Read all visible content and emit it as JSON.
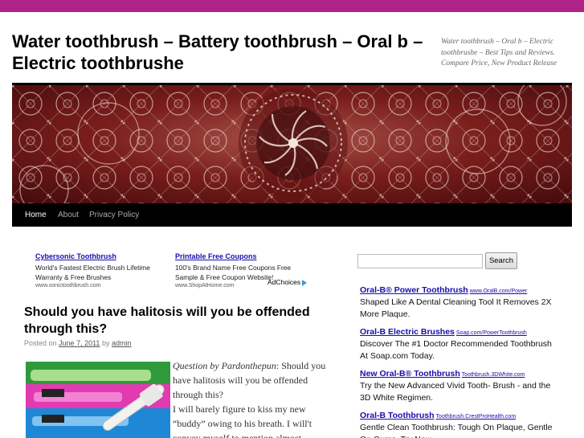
{
  "site": {
    "title": "Water toothbrush – Battery toothbrush – Oral b – Electric toothbrushe",
    "description": "Water toothbrush – Oral b – Electric toothbrushe – Best Tips and Reviews. Compare Price, New Product Release",
    "accent_color": "#b0238a"
  },
  "nav": {
    "items": [
      {
        "label": "Home",
        "active": true
      },
      {
        "label": "About",
        "active": false
      },
      {
        "label": "Privacy Policy",
        "active": false
      }
    ]
  },
  "top_ads": [
    {
      "title": "Cybersonic Toothbrush",
      "text": "World's Fastest Electric Brush Lifetime Warranty & Free Brushes",
      "url": "www.sonictoothbrush.com"
    },
    {
      "title": "Printable Free Coupons",
      "text": "100's Brand Name Free Coupons Free Sample & Free Coupon Website!",
      "url": "www.ShopAtHome.com"
    }
  ],
  "adchoices_label": "AdChoices",
  "post": {
    "title": "Should you have halitosis will you be offended through this?",
    "meta_prefix": "Posted on",
    "date": "June 7, 2011",
    "meta_by": "by",
    "author": "admin",
    "question_label": "Question by Pardonthepun",
    "question_text": ": Should you have halitosis will you be offended through this?",
    "body": "I will barely figure to kiss my new “buddy” owing to his breath. I will't convey myself to mention almost"
  },
  "search": {
    "placeholder": "",
    "button_label": "Search"
  },
  "sidebar_ads": [
    {
      "title": "Oral-B® Power Toothbrush",
      "url": "www.OralB.com/Power",
      "text": "Shaped Like A Dental Cleaning Tool It Removes 2X More Plaque."
    },
    {
      "title": "Oral-B Electric Brushes",
      "url": "Soap.com/PowerToothbrush",
      "text": "Discover The #1 Doctor Recommended Toothbrush At Soap.com Today."
    },
    {
      "title": "New Oral-B® Toothbrush",
      "url": "Toothbrush.3DWhite.com",
      "text": "Try the New Advanced Vivid Tooth- Brush - and the 3D White Regimen."
    },
    {
      "title": "Oral-B Toothbrush",
      "url": "Toothbrush.CrestProHealth.com",
      "text": "Gentle Clean Toothbrush: Tough On Plaque, Gentle On Gums. Try Now."
    }
  ]
}
